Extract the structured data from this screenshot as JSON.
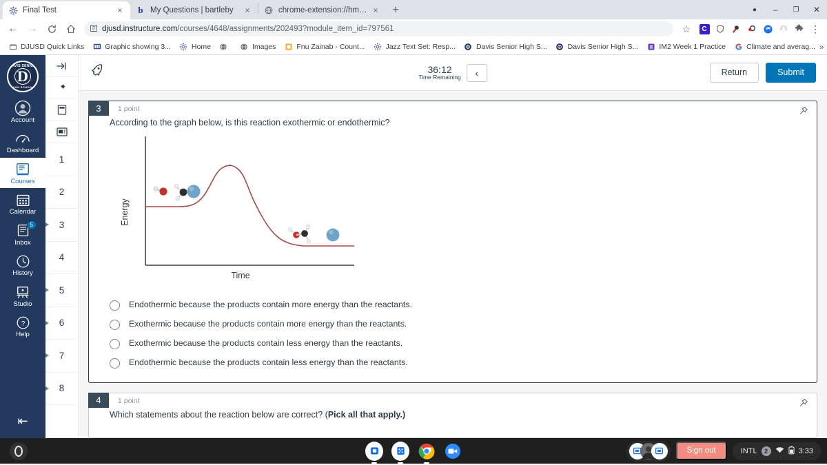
{
  "browser": {
    "tabs": [
      {
        "title": "Final Test",
        "favicon": "canvas-icon",
        "active": true,
        "close": "×"
      },
      {
        "title": "My Questions | bartleby",
        "favicon": "bartleby-icon",
        "active": false,
        "close": "×"
      },
      {
        "title": "chrome-extension://hmbjbjdpko",
        "favicon": "extension-globe-icon",
        "active": false,
        "close": "×"
      }
    ],
    "new_tab_label": "+",
    "window_controls": {
      "minimize": "–",
      "maximize": "❐",
      "close": "✕",
      "profile": "●"
    },
    "nav": {
      "back": "←",
      "forward": "→",
      "reload": "C",
      "home": "⌂"
    },
    "omnibox": {
      "site_icon": "page-info-icon",
      "host": "djusd.instructure.com",
      "path": "/courses/4648/assignments/202493?module_item_id=797561",
      "bookmark_star": "☆"
    },
    "extensions": [
      {
        "name": "grammarly-extension-icon",
        "glyph": "C",
        "color": "#15c39a"
      },
      {
        "name": "shield-extension-icon",
        "glyph": "⬡",
        "color": "#5f6368"
      },
      {
        "name": "kami-extension-icon",
        "glyph": "⬤",
        "color": "#8b1f2f"
      },
      {
        "name": "pear-deck-extension-icon",
        "glyph": "◑",
        "color": "#a32b3a"
      },
      {
        "name": "securly-extension-icon",
        "glyph": "◎",
        "color": "#1a73e8"
      },
      {
        "name": "account-extension-icon",
        "glyph": "○",
        "color": "#9aa0a6"
      },
      {
        "name": "puzzle-extensions-icon",
        "glyph": "✦",
        "color": "#5f6368"
      },
      {
        "name": "chrome-menu-icon",
        "glyph": "⋮",
        "color": "#3c4043"
      }
    ],
    "bookmarks": [
      {
        "label": "DJUSD Quick Links",
        "icon": "folder-icon"
      },
      {
        "label": "Graphic showing 3...",
        "icon": "image-icon"
      },
      {
        "label": "Home",
        "icon": "canvas-icon"
      },
      {
        "label": "",
        "icon": "globe-icon"
      },
      {
        "label": "Images",
        "icon": "globe-icon"
      },
      {
        "label": "Fnu Zainab - Count...",
        "icon": "square-yellow-icon"
      },
      {
        "label": "Jazz Text Set: Resp...",
        "icon": "canvas-icon"
      },
      {
        "label": "Davis Senior High S...",
        "icon": "davis-icon"
      },
      {
        "label": "Davis Senior High S...",
        "icon": "davis-icon"
      },
      {
        "label": "IM2 Week 1 Practice",
        "icon": "purple-list-icon"
      },
      {
        "label": "Climate and averag...",
        "icon": "google-icon"
      }
    ],
    "bookmarks_overflow": "»"
  },
  "global_nav": {
    "logo": {
      "top_text": "DAVIS SENIOR",
      "letter": "D",
      "bottom_text": "HIGH SCHOOL"
    },
    "items": [
      {
        "label": "Account",
        "icon": "account-avatar-icon",
        "active": false,
        "badge": null
      },
      {
        "label": "Dashboard",
        "icon": "dashboard-icon",
        "active": false,
        "badge": null
      },
      {
        "label": "Courses",
        "icon": "courses-book-icon",
        "active": true,
        "badge": null
      },
      {
        "label": "Calendar",
        "icon": "calendar-icon",
        "active": false,
        "badge": null
      },
      {
        "label": "Inbox",
        "icon": "inbox-icon",
        "active": false,
        "badge": "5"
      },
      {
        "label": "History",
        "icon": "history-clock-icon",
        "active": false,
        "badge": null
      },
      {
        "label": "Studio",
        "icon": "studio-icon",
        "active": false,
        "badge": null
      },
      {
        "label": "Help",
        "icon": "help-question-icon",
        "active": false,
        "badge": null
      }
    ],
    "collapse_label": "⇤"
  },
  "question_rail": {
    "tools": [
      {
        "name": "collapse-rail-icon",
        "glyph": "→|"
      },
      {
        "name": "pin-icon",
        "glyph": "⚑"
      },
      {
        "name": "calculator-icon",
        "glyph": "▣"
      },
      {
        "name": "notes-icon",
        "glyph": "☰"
      }
    ],
    "numbers": [
      {
        "label": "1",
        "flagged": false
      },
      {
        "label": "2",
        "flagged": false
      },
      {
        "label": "3",
        "flagged": true
      },
      {
        "label": "4",
        "flagged": false
      },
      {
        "label": "5",
        "flagged": true
      },
      {
        "label": "6",
        "flagged": true
      },
      {
        "label": "7",
        "flagged": true
      },
      {
        "label": "8",
        "flagged": true
      }
    ]
  },
  "quiz_header": {
    "rocket_icon": "rocket-icon",
    "timer_value": "36:12",
    "timer_label": "Time Remaining",
    "collapse_glyph": "‹",
    "return_label": "Return",
    "submit_label": "Submit"
  },
  "questions": [
    {
      "number": "3",
      "points": "1 point",
      "pin_icon": "pin-icon",
      "prompt": "According to the graph below, is this reaction exothermic or endothermic?",
      "prompt_bold": "",
      "answers": [
        "Endothermic because the products contain more energy than the reactants.",
        "Exothermic because the products contain more energy than the reactants.",
        "Exothermic because the products contain less energy than the reactants.",
        "Endothermic because the products contain less energy than the reactants."
      ]
    },
    {
      "number": "4",
      "points": "1 point",
      "pin_icon": "pin-icon",
      "prompt": "Which statements about the reaction below are correct? (",
      "prompt_bold": "Pick all that apply.)",
      "answers": []
    }
  ],
  "chart_data": {
    "type": "line",
    "title": "",
    "xlabel": "Time",
    "ylabel": "Energy",
    "grid": false,
    "legend": null,
    "axis_ranges": {
      "x": [
        0,
        100
      ],
      "y": [
        0,
        100
      ]
    },
    "series": [
      {
        "name": "Reaction energy profile",
        "color": "#a34a45",
        "points": [
          [
            0,
            52
          ],
          [
            14,
            52
          ],
          [
            20,
            53
          ],
          [
            26,
            58
          ],
          [
            32,
            70
          ],
          [
            38,
            82
          ],
          [
            44,
            88
          ],
          [
            50,
            89
          ],
          [
            56,
            85
          ],
          [
            62,
            72
          ],
          [
            68,
            56
          ],
          [
            74,
            40
          ],
          [
            80,
            30
          ],
          [
            86,
            26
          ],
          [
            92,
            25
          ],
          [
            100,
            25
          ]
        ]
      }
    ],
    "annotations": [
      {
        "label": "reactant-molecules",
        "description": "OH minus plus CH3 with leaving group",
        "x": 16,
        "y": 66
      },
      {
        "label": "product-molecules",
        "description": "CH3OH methanol plus leaving group",
        "x": 80,
        "y": 36
      }
    ],
    "reading": "Products plateau is lower in energy than the reactants plateau; an activation energy barrier peak sits between them."
  },
  "shelf": {
    "launcher_name": "launcher-icon",
    "apps": [
      {
        "name": "files-app-icon",
        "glyph": "□"
      },
      {
        "name": "calculator-app-icon",
        "glyph": "∷"
      },
      {
        "name": "chrome-app-icon",
        "glyph": "●"
      },
      {
        "name": "zoom-app-icon",
        "glyph": "▶"
      }
    ],
    "screen_pill": [
      {
        "name": "screencast-icon",
        "glyph": "■"
      },
      {
        "name": "user-avatar-icon",
        "glyph": "●"
      },
      {
        "name": "screen-share-icon",
        "glyph": "■"
      }
    ],
    "signout_label": "Sign out",
    "status": {
      "input_method": "INTL",
      "notification_count": "2",
      "wifi_icon": "wifi-icon",
      "battery_icon": "battery-icon",
      "time": "3:33"
    }
  }
}
